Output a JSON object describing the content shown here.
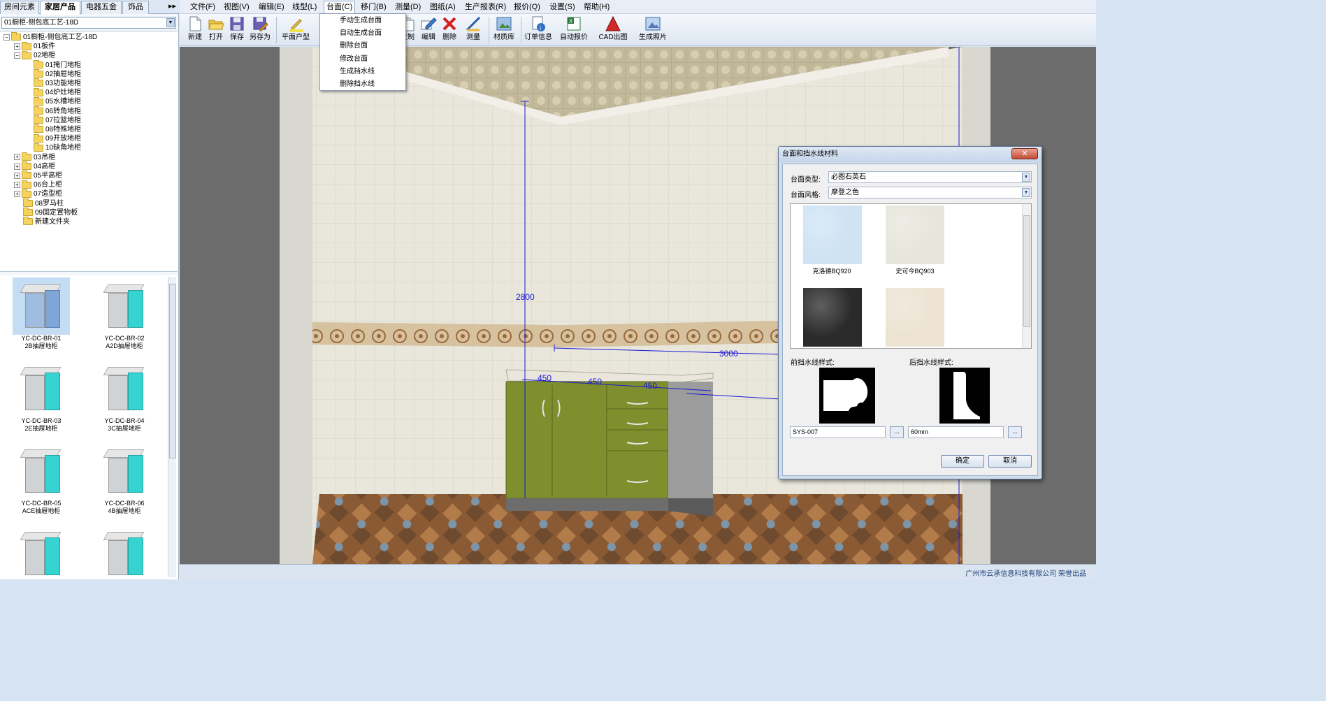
{
  "left_tabs": [
    "房间元素",
    "家居产品",
    "电器五金",
    "饰品"
  ],
  "left_tabs_arrow": "▸▸",
  "product_combo": "01橱柜-侧包底工艺-18D",
  "tree": [
    {
      "label": "01橱柜-侧包底工艺-18D",
      "level": 0,
      "expander": "−"
    },
    {
      "label": "01板件",
      "level": 1,
      "expander": "+"
    },
    {
      "label": "02地柜",
      "level": 1,
      "expander": "−"
    },
    {
      "label": "01掩门地柜",
      "level": 2,
      "expander": ""
    },
    {
      "label": "02抽屉地柜",
      "level": 2,
      "expander": ""
    },
    {
      "label": "03功能地柜",
      "level": 2,
      "expander": ""
    },
    {
      "label": "04炉灶地柜",
      "level": 2,
      "expander": ""
    },
    {
      "label": "05水槽地柜",
      "level": 2,
      "expander": ""
    },
    {
      "label": "06转角地柜",
      "level": 2,
      "expander": ""
    },
    {
      "label": "07拉篮地柜",
      "level": 2,
      "expander": ""
    },
    {
      "label": "08特殊地柜",
      "level": 2,
      "expander": ""
    },
    {
      "label": "09开放地柜",
      "level": 2,
      "expander": ""
    },
    {
      "label": "10缺角地柜",
      "level": 2,
      "expander": ""
    },
    {
      "label": "03吊柜",
      "level": 1,
      "expander": "+"
    },
    {
      "label": "04高柜",
      "level": 1,
      "expander": "+"
    },
    {
      "label": "05半高柜",
      "level": 1,
      "expander": "+"
    },
    {
      "label": "06台上柜",
      "level": 1,
      "expander": "+"
    },
    {
      "label": "07造型柜",
      "level": 1,
      "expander": "+"
    },
    {
      "label": "08罗马柱",
      "level": 1,
      "expander": ""
    },
    {
      "label": "09固定置物板",
      "level": 1,
      "expander": ""
    },
    {
      "label": "新建文件夹",
      "level": 1,
      "expander": ""
    }
  ],
  "thumbs": [
    {
      "code": "YC-DC-BR-01",
      "name": "2B抽屉地柜",
      "selected": true
    },
    {
      "code": "YC-DC-BR-02",
      "name": "A2D抽屉地柜",
      "selected": false
    },
    {
      "code": "YC-DC-BR-03",
      "name": "2E抽屉地柜",
      "selected": false
    },
    {
      "code": "YC-DC-BR-04",
      "name": "3C抽屉地柜",
      "selected": false
    },
    {
      "code": "YC-DC-BR-05",
      "name": "ACE抽屉地柜",
      "selected": false
    },
    {
      "code": "YC-DC-BR-06",
      "name": "4B抽屉地柜",
      "selected": false
    },
    {
      "code": "",
      "name": "",
      "selected": false
    },
    {
      "code": "",
      "name": "",
      "selected": false
    }
  ],
  "menu": [
    "文件(F)",
    "视图(V)",
    "编辑(E)",
    "线型(L)",
    "台面(C)",
    "移门(B)",
    "测量(D)",
    "图纸(A)",
    "生产报表(R)",
    "报价(Q)",
    "设置(S)",
    "帮助(H)"
  ],
  "toolbar": {
    "new": "新建",
    "open": "打开",
    "save": "保存",
    "save_as": "另存为",
    "plan": "平面户型",
    "copy": "复制",
    "edit": "编辑",
    "delete": "删除",
    "measure": "测量",
    "materials": "材质库",
    "order_info": "订单信息",
    "auto_quote": "自动报价",
    "cad_out": "CAD出图",
    "photo": "生成照片"
  },
  "countertop_menu": [
    "手动生成台面",
    "自动生成台面",
    "删除台面",
    "修改台面",
    "生成挡水线",
    "删除挡水线"
  ],
  "dimensions": {
    "height": "2800",
    "width": "3000",
    "seg1": "450",
    "seg2": "450",
    "seg3": "450"
  },
  "dialog": {
    "title": "台面和挡水线材料",
    "close": "✕",
    "type_label": "台面类型:",
    "type_value": "必图石英石",
    "style_label": "台面风格:",
    "style_value": "摩登之色",
    "swatches": [
      {
        "name": "克洛德BQ920",
        "color": "#cfe3f4"
      },
      {
        "name": "史可今BQ903",
        "color": "#e6e6dc"
      },
      {
        "name": "",
        "color": "#2a2a2a"
      },
      {
        "name": "",
        "color": "#ece3d2"
      }
    ],
    "front_label": "前挡水线样式:",
    "back_label": "后挡水线样式:",
    "front_value": "SYS-007",
    "back_value": "60mm",
    "dots": "...",
    "ok": "确定",
    "cancel": "取消"
  },
  "status": "广州市云承信息科技有限公司 荣誉出品",
  "colors": {
    "cabinet_green": "#7f8f2e",
    "dim_blue": "#1a1ad4",
    "accent": "#3a6fb8"
  }
}
